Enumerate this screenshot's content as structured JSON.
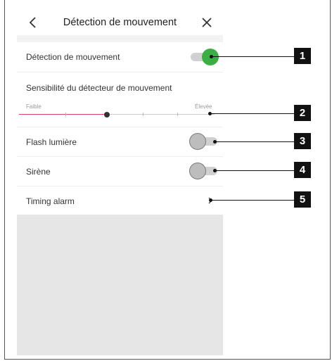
{
  "header": {
    "title": "Détection de mouvement",
    "back_icon": "chevron-left-icon",
    "close_icon": "close-icon"
  },
  "settings": {
    "motion_detection": {
      "label": "Détection de mouvement",
      "enabled": true
    },
    "sensitivity": {
      "label": "Sensibilité du détecteur de mouvement",
      "min_label": "Faible",
      "max_label": "Élevée",
      "value": 0.45
    },
    "flash_light": {
      "label": "Flash lumière",
      "enabled": false
    },
    "siren": {
      "label": "Sirène",
      "enabled": false
    },
    "timing_alarm": {
      "label": "Timing alarm",
      "icon": "chevron-right-icon"
    }
  },
  "callouts": [
    "1",
    "2",
    "3",
    "4",
    "5"
  ],
  "colors": {
    "toggle_on": "#3cae45",
    "toggle_off": "#bdbdbd",
    "slider_fill": "#d9465e",
    "background": "#e6e6e6"
  }
}
